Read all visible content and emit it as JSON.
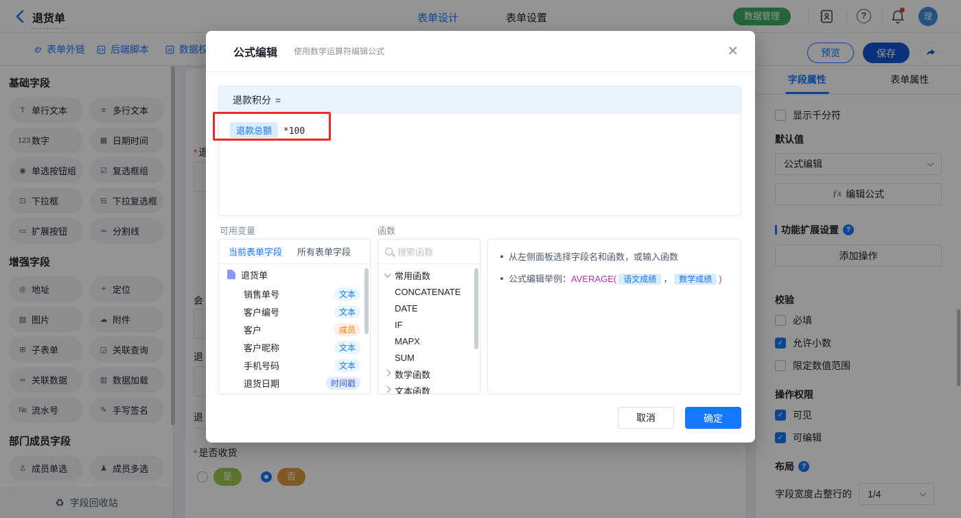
{
  "colors": {
    "primary_blue": "#1677ff",
    "save_blue": "#1455d6",
    "data_manage_green": "#3dae67",
    "avatar_blue": "#3e8ee0",
    "annotation_red": "#ee2b23",
    "formula_header_bg": "#e9f4fe",
    "chip_bg": "#d9ecff",
    "tag_text_bg": "#e8f7ff",
    "tag_text_color": "#1677ff",
    "tag_member_bg": "#ffefe3",
    "tag_member_color": "#ff7d00",
    "tag_timestamp_bg": "#e3ebff",
    "tag_timestamp_color": "#3a5bf0",
    "option_yes_green": "#9cc94d",
    "option_no_orange": "#dd9a41",
    "example_func_purple": "#ad35ad"
  },
  "header": {
    "title": "退货单",
    "nav_tabs": [
      {
        "label": "表单设计",
        "active": true
      },
      {
        "label": "表单设置",
        "active": false
      }
    ],
    "data_manage_label": "数据管理",
    "avatar_text": "理"
  },
  "toolbar": {
    "links": [
      {
        "label": "表单外链",
        "icon": "link-icon"
      },
      {
        "label": "后端脚本",
        "icon": "script-icon"
      },
      {
        "label": "数据权",
        "icon": "data-permission-icon"
      }
    ],
    "preview_label": "预览",
    "save_label": "保存"
  },
  "sidebar": {
    "sections": [
      {
        "title": "基础字段",
        "items": [
          {
            "label": "单行文本",
            "icon": "single-line-text-icon",
            "glyph": "T"
          },
          {
            "label": "多行文本",
            "icon": "multi-line-text-icon",
            "glyph": "≡"
          },
          {
            "label": "数字",
            "icon": "number-icon",
            "glyph": "123"
          },
          {
            "label": "日期时间",
            "icon": "datetime-icon",
            "glyph": "▦"
          },
          {
            "label": "单选按钮组",
            "icon": "radio-group-icon",
            "glyph": "◉"
          },
          {
            "label": "复选框组",
            "icon": "checkbox-group-icon",
            "glyph": "☑"
          },
          {
            "label": "下拉框",
            "icon": "select-icon",
            "glyph": "⊡"
          },
          {
            "label": "下拉复选框",
            "icon": "multi-select-icon",
            "glyph": "⊟"
          },
          {
            "label": "扩展按钮",
            "icon": "extend-button-icon",
            "glyph": "▭"
          },
          {
            "label": "分割线",
            "icon": "divider-icon",
            "glyph": "═"
          }
        ]
      },
      {
        "title": "增强字段",
        "items": [
          {
            "label": "地址",
            "icon": "address-icon",
            "glyph": "◎"
          },
          {
            "label": "定位",
            "icon": "location-icon",
            "glyph": "⌖"
          },
          {
            "label": "图片",
            "icon": "image-icon",
            "glyph": "▨"
          },
          {
            "label": "附件",
            "icon": "attachment-icon",
            "glyph": "☁"
          },
          {
            "label": "子表单",
            "icon": "subform-icon",
            "glyph": "⊞"
          },
          {
            "label": "关联查询",
            "icon": "linked-query-icon",
            "glyph": "◲"
          },
          {
            "label": "关联数据",
            "icon": "linked-data-icon",
            "glyph": "∞"
          },
          {
            "label": "数据加载",
            "icon": "data-load-icon",
            "glyph": "▥"
          },
          {
            "label": "流水号",
            "icon": "serial-number-icon",
            "glyph": "№"
          },
          {
            "label": "手写签名",
            "icon": "signature-icon",
            "glyph": "✎"
          }
        ]
      },
      {
        "title": "部门成员字段",
        "items": [
          {
            "label": "成员单选",
            "icon": "member-single-icon",
            "glyph": "♙"
          },
          {
            "label": "成员多选",
            "icon": "member-multi-icon",
            "glyph": "♟"
          }
        ]
      }
    ],
    "recycle_label": "字段回收站"
  },
  "canvas": {
    "partial_field_labels": [
      {
        "text": "退",
        "required": true
      },
      {
        "text": "会",
        "required": false
      },
      {
        "text": "退",
        "required": false
      },
      {
        "text": "退",
        "required": false
      }
    ],
    "receive_field": {
      "label": "是否收货",
      "required": true,
      "options": [
        {
          "label": "是",
          "selected": false
        },
        {
          "label": "否",
          "selected": true
        }
      ]
    }
  },
  "modal": {
    "title": "公式编辑",
    "subtitle": "使用数学运算符编辑公式",
    "close_glyph": "✕",
    "formula": {
      "target_field": "退款积分",
      "equals": "=",
      "variable_chip": "退款总额",
      "expression": "*100"
    },
    "variables": {
      "label": "可用变量",
      "tabs": [
        {
          "label": "当前表单字段",
          "active": true
        },
        {
          "label": "所有表单字段",
          "active": false
        }
      ],
      "tree_root": "退货单",
      "fields": [
        {
          "name": "销售单号",
          "tag": "文本",
          "tag_type": "text"
        },
        {
          "name": "客户编号",
          "tag": "文本",
          "tag_type": "text"
        },
        {
          "name": "客户",
          "tag": "成员",
          "tag_type": "member"
        },
        {
          "name": "客户昵称",
          "tag": "文本",
          "tag_type": "text"
        },
        {
          "name": "手机号码",
          "tag": "文本",
          "tag_type": "text"
        },
        {
          "name": "退货日期",
          "tag": "时间戳",
          "tag_type": "timestamp"
        }
      ]
    },
    "functions": {
      "label": "函数",
      "search_placeholder": "搜索函数",
      "expanded_group": "常用函数",
      "items": [
        "CONCATENATE",
        "DATE",
        "IF",
        "MAPX",
        "SUM"
      ],
      "collapsed_groups": [
        "数学函数",
        "文本函数"
      ]
    },
    "tips": {
      "line1": "从左侧面板选择字段名和函数，或输入函数",
      "line2_prefix": "公式编辑举例：",
      "line2_func": "AVERAGE(",
      "line2_chip1": "语文成绩",
      "line2_comma": "，",
      "line2_chip2": "数学成绩",
      "line2_close": ")"
    },
    "cancel_label": "取消",
    "confirm_label": "确定"
  },
  "properties": {
    "tabs": [
      {
        "label": "字段属性",
        "active": true
      },
      {
        "label": "表单属性",
        "active": false
      }
    ],
    "thousand_separator": {
      "label": "显示千分符",
      "checked": false
    },
    "default_value": {
      "label": "默认值",
      "select_value": "公式编辑",
      "fx_glyph": "ƒx",
      "edit_formula_label": "编辑公式"
    },
    "extension": {
      "title": "功能扩展设置",
      "add_action_label": "添加操作"
    },
    "validation": {
      "title": "校验",
      "options": [
        {
          "label": "必填",
          "checked": false
        },
        {
          "label": "允许小数",
          "checked": true
        },
        {
          "label": "限定数值范围",
          "checked": false
        }
      ]
    },
    "permission": {
      "title": "操作权限",
      "options": [
        {
          "label": "可见",
          "checked": true
        },
        {
          "label": "可编辑",
          "checked": true
        }
      ]
    },
    "layout": {
      "title": "布局",
      "width_label": "字段宽度占整行的",
      "width_value": "1/4"
    }
  }
}
